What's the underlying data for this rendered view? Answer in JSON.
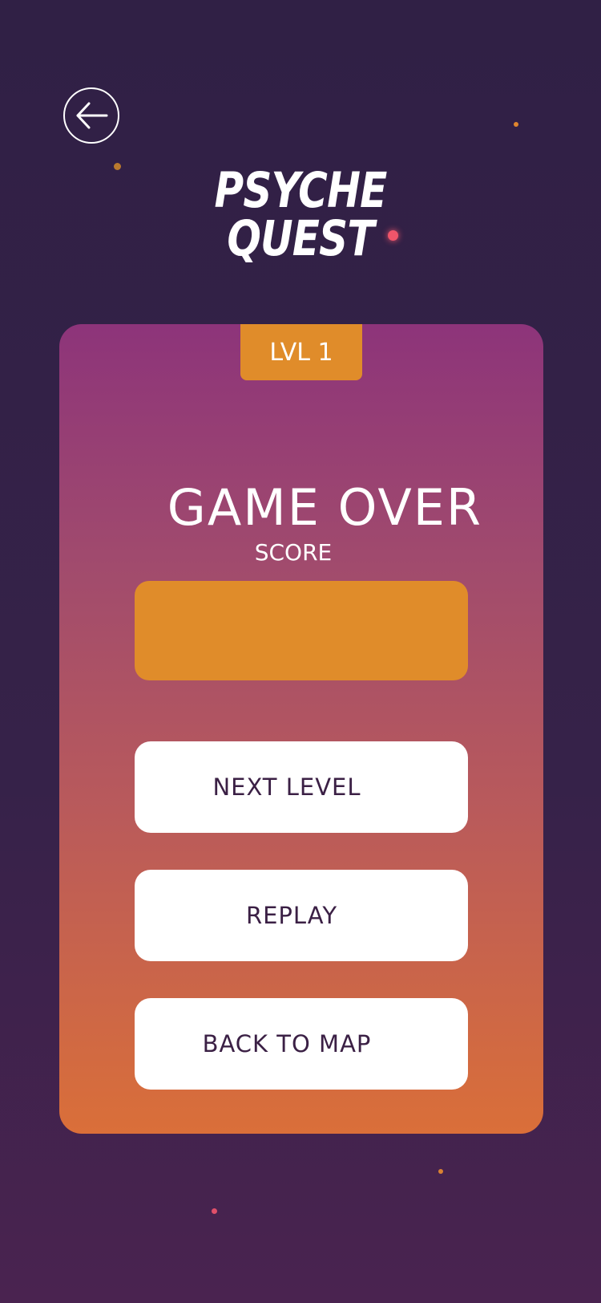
{
  "header": {
    "title_line1": "PSYCHE",
    "title_line2": "QUEST",
    "back_icon": "arrow-left-icon"
  },
  "card": {
    "level_badge": "LVL 1",
    "heading": "GAME OVER",
    "score_label": "SCORE",
    "score_value": "",
    "buttons": {
      "next_level": "NEXT LEVEL",
      "replay": "REPLAY",
      "back_to_map": "BACK TO MAP"
    }
  },
  "colors": {
    "background": "#302045",
    "accent_orange": "#e08c2a",
    "card_top": "#8d347a",
    "card_bottom": "#da6f39",
    "button_text": "#3b2045"
  }
}
